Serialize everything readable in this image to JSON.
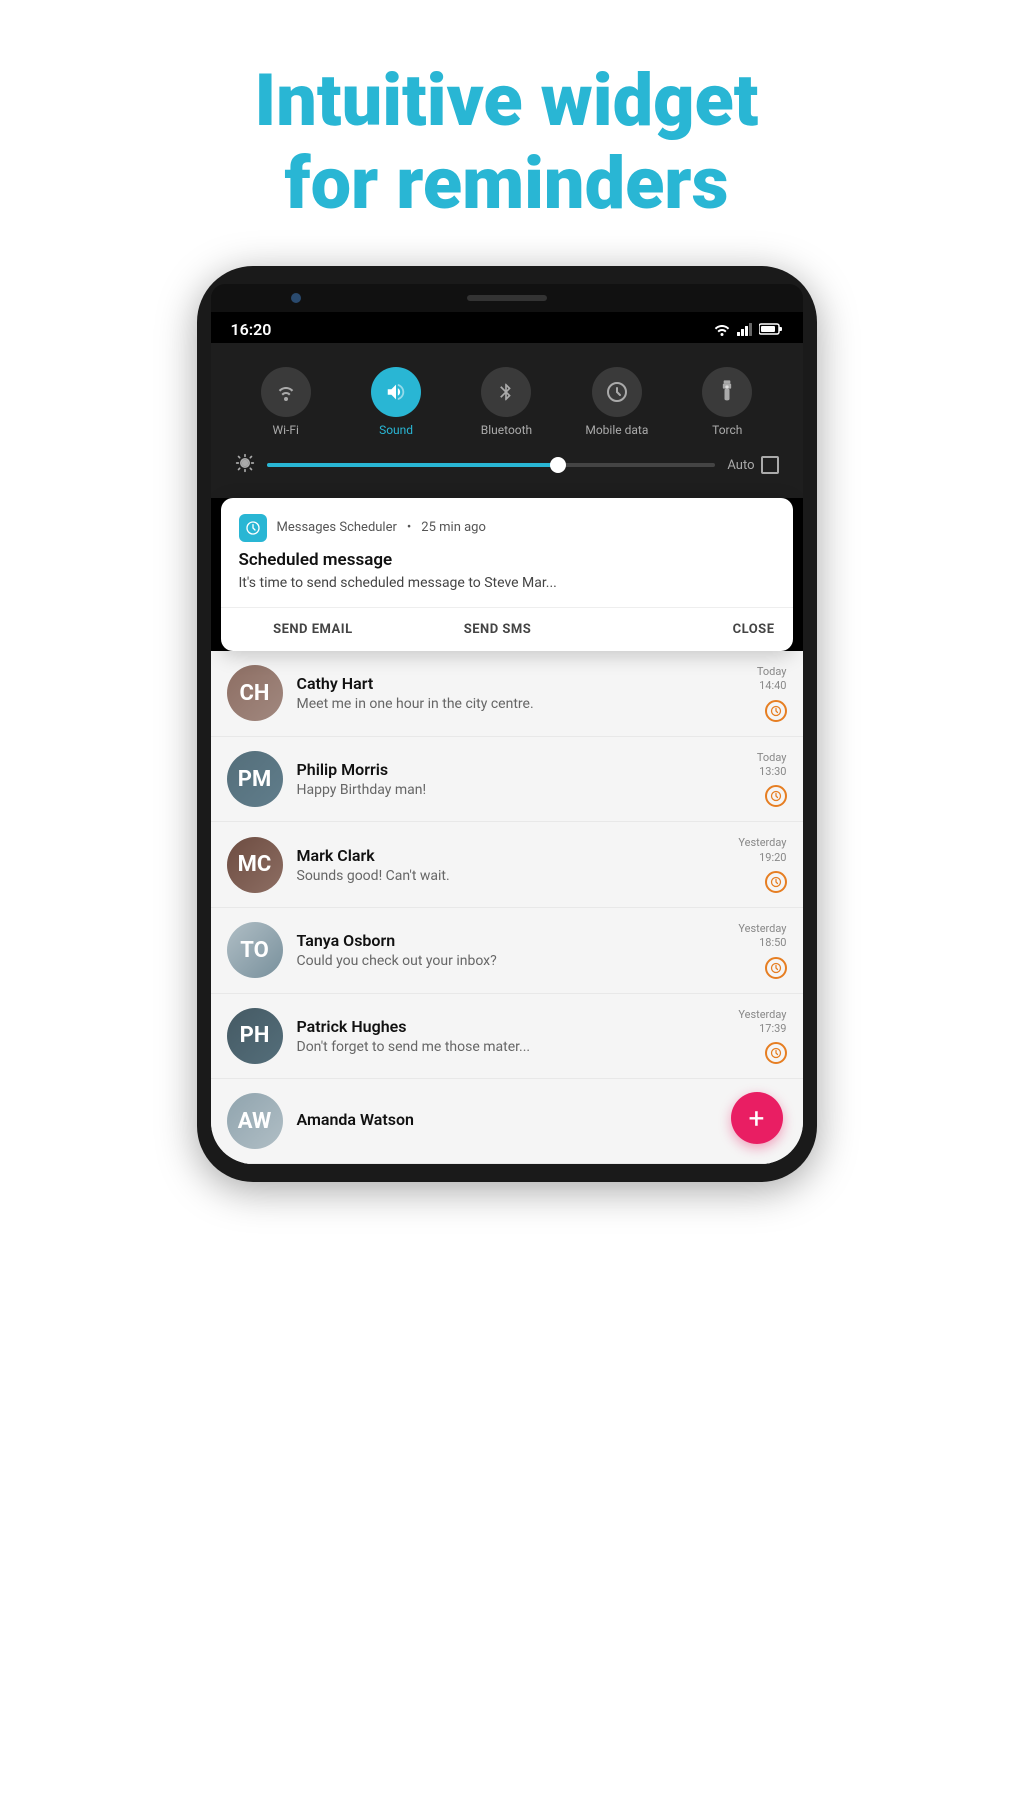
{
  "hero": {
    "line1": "Intuitive widget",
    "line2": "for reminders"
  },
  "status_bar": {
    "time": "16:20"
  },
  "quick_settings": {
    "icons": [
      {
        "id": "wifi",
        "label": "Wi-Fi",
        "active": false,
        "symbol": "📶"
      },
      {
        "id": "sound",
        "label": "Sound",
        "active": true,
        "symbol": "🔊"
      },
      {
        "id": "bluetooth",
        "label": "Bluetooth",
        "active": false,
        "symbol": "✱"
      },
      {
        "id": "mobile-data",
        "label": "Mobile data",
        "active": false,
        "symbol": "⏸"
      },
      {
        "id": "torch",
        "label": "Torch",
        "active": false,
        "symbol": "🔦"
      }
    ],
    "brightness": {
      "fill_percent": 65,
      "auto_label": "Auto"
    }
  },
  "notification": {
    "app_name": "Messages Scheduler",
    "time_ago": "25 min ago",
    "title": "Scheduled message",
    "body": "It's time to send scheduled message to Steve Mar...",
    "actions": {
      "send_email": "SEND EMAIL",
      "send_sms": "SEND SMS",
      "close": "CLOSE"
    }
  },
  "messages": [
    {
      "name": "Cathy Hart",
      "preview": "Meet me in one hour in the city centre.",
      "time": "Today\n14:40",
      "avatar_class": "av-cathy",
      "avatar_initials": "CH"
    },
    {
      "name": "Philip Morris",
      "preview": "Happy Birthday man!",
      "time": "Today\n13:30",
      "avatar_class": "av-philip",
      "avatar_initials": "PM"
    },
    {
      "name": "Mark Clark",
      "preview": "Sounds good! Can't wait.",
      "time": "Yesterday\n19:20",
      "avatar_class": "av-mark",
      "avatar_initials": "MC"
    },
    {
      "name": "Tanya Osborn",
      "preview": "Could you check out your inbox?",
      "time": "Yesterday\n18:50",
      "avatar_class": "av-tanya",
      "avatar_initials": "TO"
    },
    {
      "name": "Patrick Hughes",
      "preview": "Don't forget to send me those mater...",
      "time": "Yesterday\n17:39",
      "avatar_class": "av-patrick",
      "avatar_initials": "PH"
    },
    {
      "name": "Amanda Watson",
      "preview": "",
      "time": "",
      "avatar_class": "av-amanda",
      "avatar_initials": "AW"
    }
  ],
  "fab": {
    "label": "+"
  }
}
